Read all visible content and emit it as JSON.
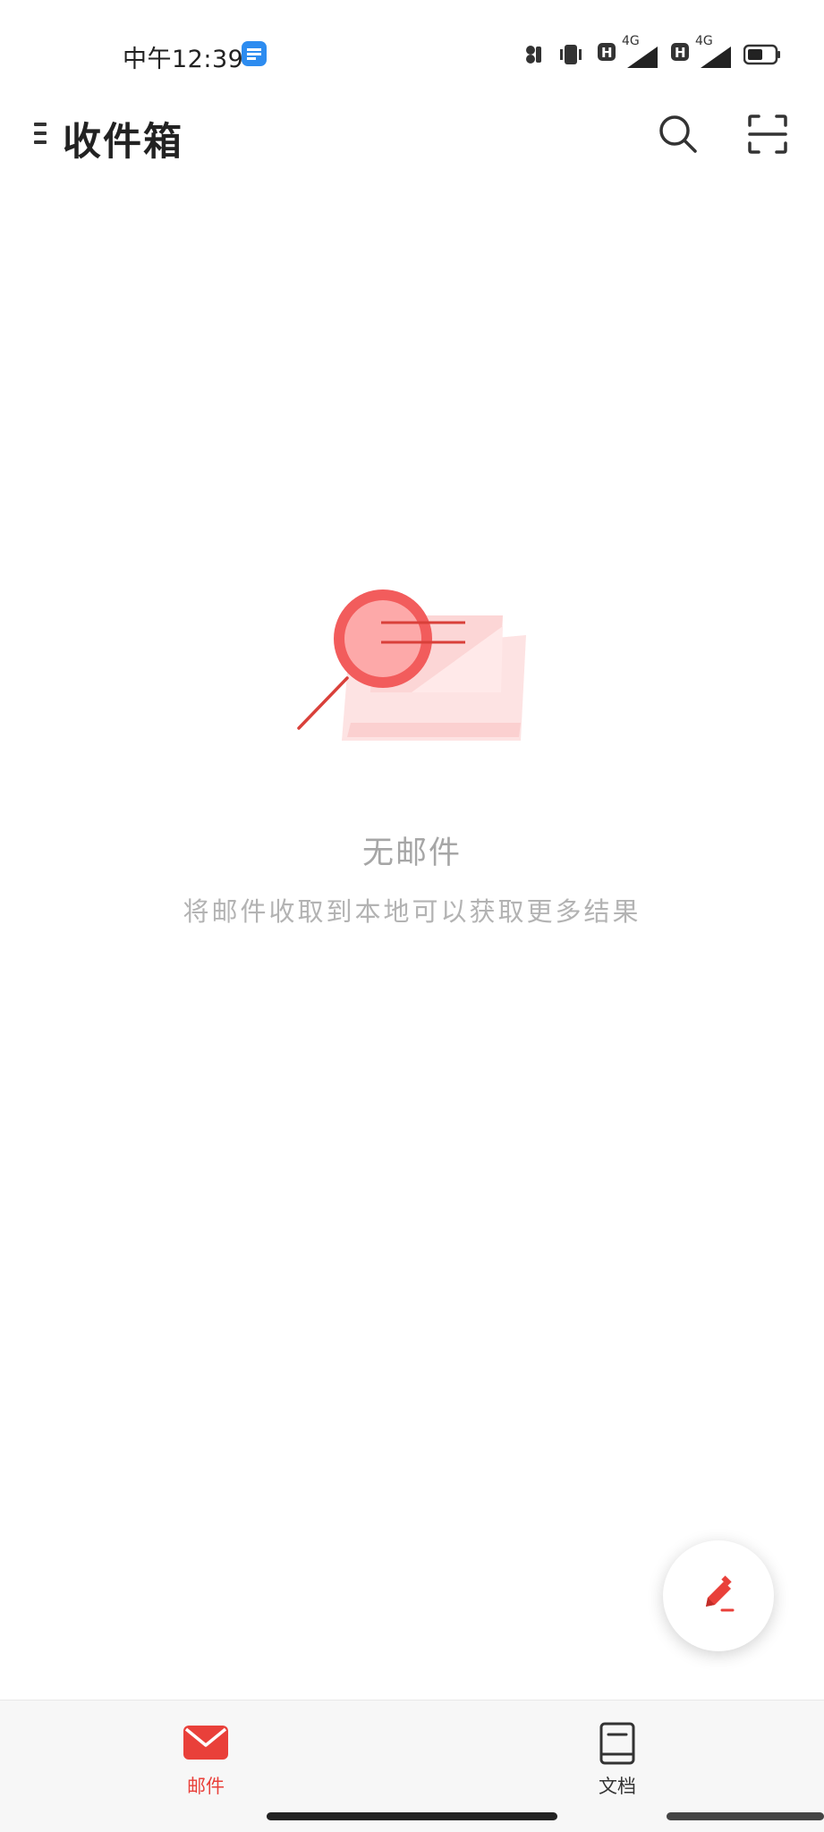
{
  "status_bar": {
    "time": "中午12:39",
    "network_label_1": "4G",
    "network_label_2": "4G"
  },
  "header": {
    "title": "收件箱"
  },
  "empty_state": {
    "title": "无邮件",
    "hint": "将邮件收取到本地可以获取更多结果"
  },
  "bottom_nav": {
    "mail_label": "邮件",
    "docs_label": "文档"
  },
  "icons": {
    "menu": "menu-icon",
    "search": "search-icon",
    "scan": "scan-icon",
    "compose": "pencil-icon",
    "mail": "envelope-icon",
    "docs": "document-icon"
  },
  "colors": {
    "accent": "#e9403a",
    "illustration_red": "#f25c5c",
    "illustration_pink": "#fcd6d6",
    "muted_text": "#a6a6a6"
  }
}
